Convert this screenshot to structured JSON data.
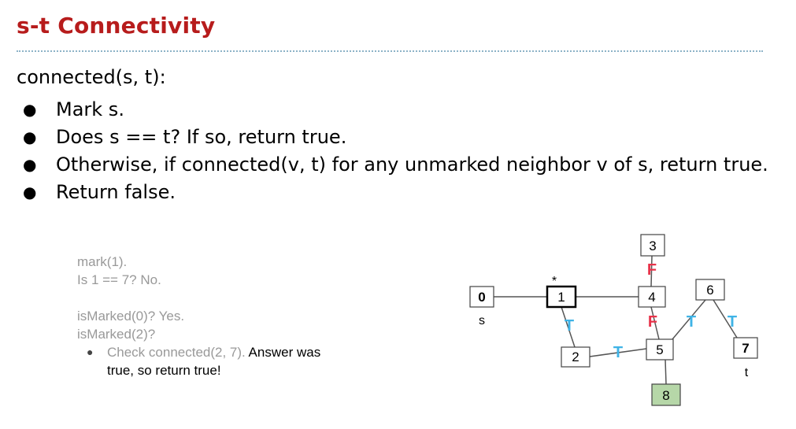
{
  "slide": {
    "title": "s-t Connectivity",
    "signature": "connected(s, t):",
    "steps": [
      "Mark s.",
      "Does s == t? If so, return true.",
      "Otherwise, if connected(v, t) for any unmarked neighbor v of s, return true.",
      "Return false."
    ],
    "bullet": "●"
  },
  "trace": {
    "line1": "mark(1).",
    "line2": "Is 1 == 7? No.",
    "line3": "isMarked(0)? Yes.",
    "line4": "isMarked(2)?",
    "sub_gray": "Check connected(2, 7).",
    "sub_dark": " Answer was",
    "sub_line2": "true, so return true!"
  },
  "graph": {
    "nodes": [
      {
        "id": "0",
        "bold": true,
        "fill": "#ffffff"
      },
      {
        "id": "1",
        "bold": false,
        "fill": "#ffffff",
        "current": true
      },
      {
        "id": "2",
        "bold": false,
        "fill": "#ffffff"
      },
      {
        "id": "3",
        "bold": false,
        "fill": "#ffffff"
      },
      {
        "id": "4",
        "bold": false,
        "fill": "#ffffff"
      },
      {
        "id": "5",
        "bold": false,
        "fill": "#ffffff"
      },
      {
        "id": "6",
        "bold": false,
        "fill": "#ffffff"
      },
      {
        "id": "7",
        "bold": true,
        "fill": "#ffffff"
      },
      {
        "id": "8",
        "bold": false,
        "fill": "#b6d7a8"
      }
    ],
    "source_label": "s",
    "target_label": "t",
    "current_marker": "*",
    "edge_marks": [
      {
        "letter": "T",
        "color": "#3fb3e6"
      },
      {
        "letter": "F",
        "color": "#e8334a"
      },
      {
        "letter": "F",
        "color": "#e8334a"
      },
      {
        "letter": "T",
        "color": "#3fb3e6"
      },
      {
        "letter": "T",
        "color": "#3fb3e6"
      },
      {
        "letter": "T",
        "color": "#3fb3e6"
      }
    ]
  },
  "colors": {
    "title": "#b71c1c",
    "rule": "#8db3c7",
    "trace_gray": "#999999"
  }
}
